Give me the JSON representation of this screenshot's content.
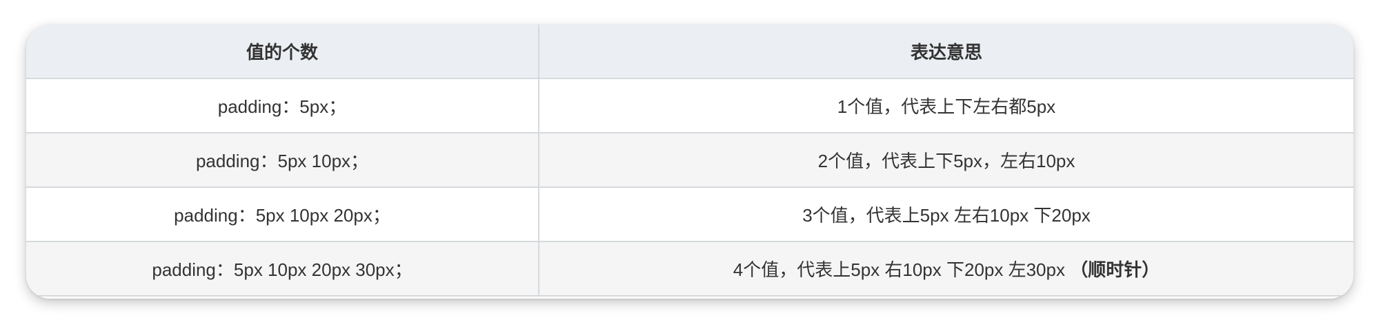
{
  "table": {
    "headers": [
      "值的个数",
      "表达意思"
    ],
    "rows": [
      {
        "count": "padding：5px；",
        "meaning": "1个值，代表上下左右都5px",
        "note": ""
      },
      {
        "count": "padding：5px 10px；",
        "meaning": "2个值，代表上下5px，左右10px",
        "note": ""
      },
      {
        "count": "padding：5px 10px 20px；",
        "meaning": "3个值，代表上5px 左右10px 下20px",
        "note": ""
      },
      {
        "count": "padding：5px 10px 20px 30px；",
        "meaning": "4个值，代表上5px 右10px 下20px 左30px ",
        "note": "（顺时针）"
      }
    ]
  },
  "colors": {
    "header_bg": "#ebeef2",
    "row_alt_bg": "#f5f5f5",
    "border": "#d5d8dc",
    "text": "#333333"
  }
}
